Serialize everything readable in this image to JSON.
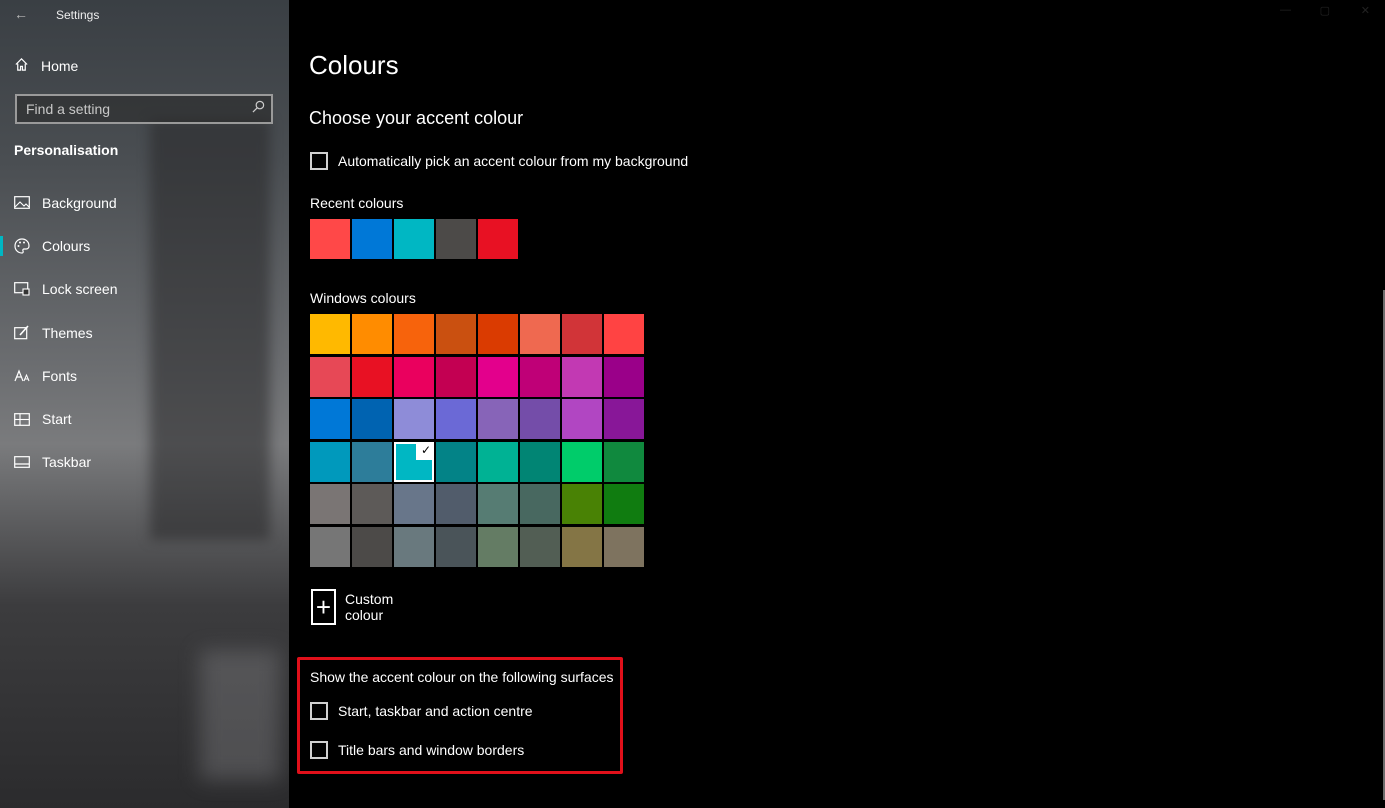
{
  "window": {
    "title": "Settings",
    "back_glyph": "←"
  },
  "sidebar": {
    "home_label": "Home",
    "search_placeholder": "Find a setting",
    "section_title": "Personalisation",
    "items": [
      {
        "label": "Background",
        "icon": "image-icon",
        "active": false
      },
      {
        "label": "Colours",
        "icon": "palette-icon",
        "active": true
      },
      {
        "label": "Lock screen",
        "icon": "lock-screen-icon",
        "active": false
      },
      {
        "label": "Themes",
        "icon": "themes-icon",
        "active": false
      },
      {
        "label": "Fonts",
        "icon": "fonts-icon",
        "active": false
      },
      {
        "label": "Start",
        "icon": "start-icon",
        "active": false
      },
      {
        "label": "Taskbar",
        "icon": "taskbar-icon",
        "active": false
      }
    ]
  },
  "main": {
    "page_title": "Colours",
    "accent_heading": "Choose your accent colour",
    "auto_pick_label": "Automatically pick an accent colour from my background",
    "recent_label": "Recent colours",
    "recent_colours": [
      "#ff4848",
      "#0078d7",
      "#00b7c3",
      "#4c4a48",
      "#e81123"
    ],
    "windows_label": "Windows colours",
    "windows_colours": [
      [
        "#ffb900",
        "#ff8c00",
        "#f7630c",
        "#ca5010",
        "#da3b01",
        "#ef6950",
        "#d13438",
        "#ff4343"
      ],
      [
        "#e74856",
        "#e81123",
        "#ea005e",
        "#c30052",
        "#e3008c",
        "#bf0077",
        "#c239b3",
        "#9a0089"
      ],
      [
        "#0078d7",
        "#0063b1",
        "#8e8cd8",
        "#6b69d6",
        "#8764b8",
        "#744da9",
        "#b146c2",
        "#881798"
      ],
      [
        "#0099bc",
        "#2d7d9a",
        "#00b7c3",
        "#038387",
        "#00b294",
        "#018574",
        "#00cc6a",
        "#10893e"
      ],
      [
        "#7a7574",
        "#5d5a58",
        "#68768a",
        "#515c6b",
        "#567c73",
        "#486860",
        "#498205",
        "#107c10"
      ],
      [
        "#767676",
        "#4c4a48",
        "#69797e",
        "#4a5459",
        "#647c64",
        "#525e54",
        "#847545",
        "#7e735f"
      ]
    ],
    "selected_colour": {
      "row": 3,
      "col": 2
    },
    "custom_colour_label": "Custom colour",
    "surfaces_heading": "Show the accent colour on the following surfaces",
    "surface_options": [
      "Start, taskbar and action centre",
      "Title bars and window borders"
    ]
  },
  "colors": {
    "accent": "#00b7c3",
    "highlight_border": "#e0101a"
  }
}
